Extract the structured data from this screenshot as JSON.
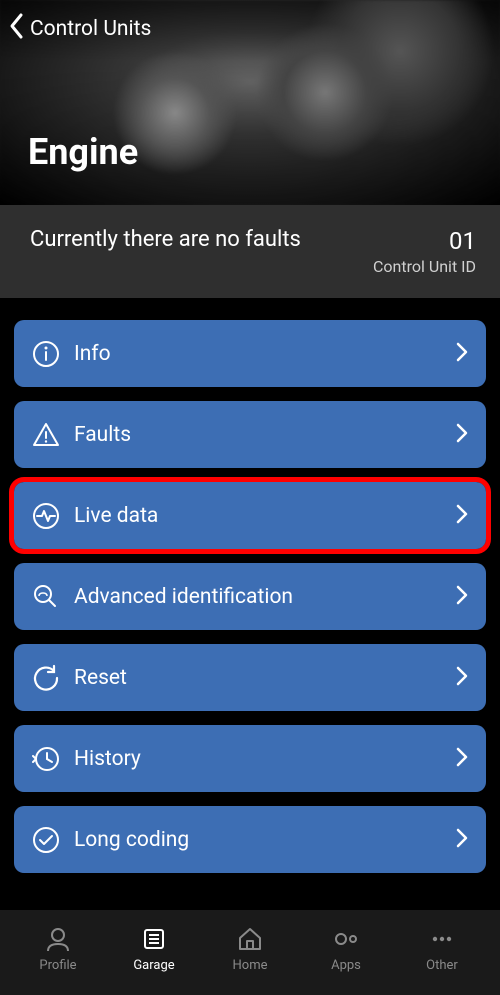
{
  "header": {
    "back_label": "Control Units",
    "title": "Engine"
  },
  "status": {
    "text": "Currently there are no faults",
    "unit_id": "01",
    "unit_id_label": "Control Unit ID"
  },
  "menu": {
    "items": [
      {
        "icon": "info-icon",
        "label": "Info",
        "highlighted": false
      },
      {
        "icon": "warning-icon",
        "label": "Faults",
        "highlighted": false
      },
      {
        "icon": "pulse-icon",
        "label": "Live data",
        "highlighted": true
      },
      {
        "icon": "search-car-icon",
        "label": "Advanced identification",
        "highlighted": false
      },
      {
        "icon": "reset-icon",
        "label": "Reset",
        "highlighted": false
      },
      {
        "icon": "history-icon",
        "label": "History",
        "highlighted": false
      },
      {
        "icon": "check-circle-icon",
        "label": "Long coding",
        "highlighted": false
      }
    ]
  },
  "tabs": {
    "items": [
      {
        "icon": "profile-icon",
        "label": "Profile",
        "active": false
      },
      {
        "icon": "garage-icon",
        "label": "Garage",
        "active": true
      },
      {
        "icon": "home-icon",
        "label": "Home",
        "active": false
      },
      {
        "icon": "apps-icon",
        "label": "Apps",
        "active": false
      },
      {
        "icon": "other-icon",
        "label": "Other",
        "active": false
      }
    ]
  }
}
